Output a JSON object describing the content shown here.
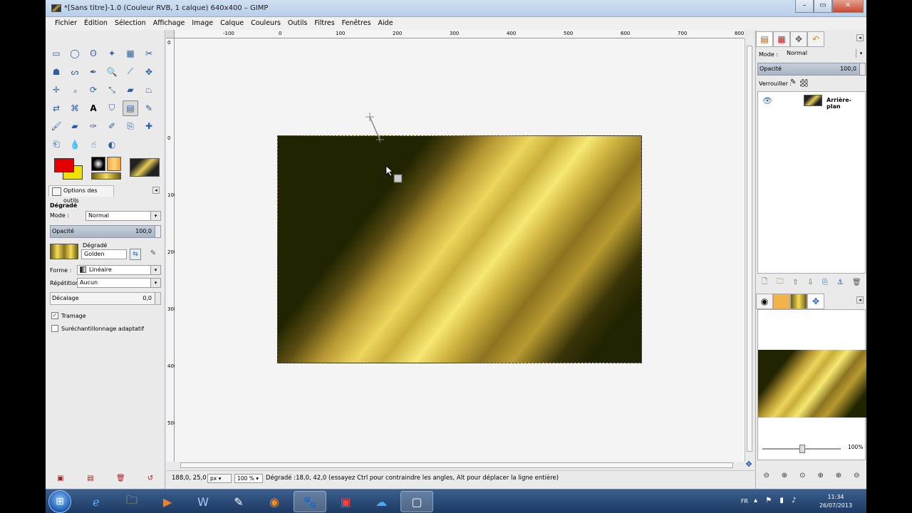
{
  "window": {
    "title": "*[Sans titre]-1.0 (Couleur RVB, 1 calque) 640x400 – GIMP",
    "buttons": [
      "–",
      "▭",
      "✕"
    ]
  },
  "menu": [
    "Fichier",
    "Édition",
    "Sélection",
    "Affichage",
    "Image",
    "Calque",
    "Couleurs",
    "Outils",
    "Filtres",
    "Fenêtres",
    "Aide"
  ],
  "tool_options": {
    "tab_label": "Options des outils",
    "heading": "Dégradé",
    "mode_label": "Mode :",
    "mode_value": "Normal",
    "opacity_label": "Opacité",
    "opacity_value": "100,0",
    "gradient_label": "Dégradé",
    "gradient_value": "Golden",
    "shape_label": "Forme :",
    "shape_value": "Linéaire",
    "repeat_label": "Répétition :",
    "repeat_value": "Aucun",
    "offset_label": "Décalage",
    "offset_value": "0,0",
    "dither_label": "Tramage",
    "dither_checked": true,
    "supersample_label": "Suréchantillonnage adaptatif",
    "supersample_checked": false
  },
  "colors": {
    "foreground": "#e40000",
    "background": "#f2df08"
  },
  "rulers": {
    "horizontal": [
      "-100",
      "0",
      "100",
      "200",
      "300",
      "400",
      "500",
      "600",
      "700",
      "800"
    ],
    "vertical": [
      "0",
      "0",
      "100",
      "200",
      "300",
      "400",
      "500"
    ]
  },
  "status": {
    "coords": "188,0, 25,0",
    "unit": "px",
    "zoom": "100 %",
    "message": "Dégradé :18,0, 42,0 (essayez Ctrl pour contraindre les angles, Alt pour déplacer la ligne entière)"
  },
  "layers": {
    "mode_label": "Mode :",
    "mode_value": "Normal",
    "opacity_label": "Opacité",
    "opacity_value": "100,0",
    "lock_label": "Verrouiller :",
    "items": [
      {
        "name": "Arrière-plan",
        "visible": true
      }
    ]
  },
  "navigation": {
    "zoom_percent": "100%"
  },
  "taskbar": {
    "language": "FR",
    "time": "11:34",
    "date": "26/07/2013"
  }
}
